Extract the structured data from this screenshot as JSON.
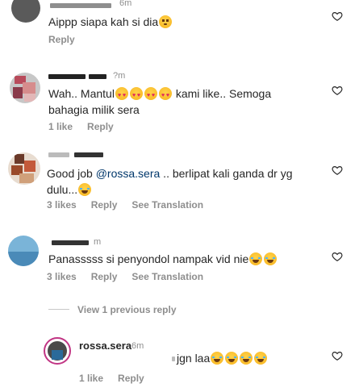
{
  "comments": [
    {
      "id": "c1",
      "username_visible": "",
      "time": "6m",
      "text": "Aippp siapa kah si dia",
      "emojis": [
        "flushed"
      ],
      "actions": {
        "likes": "",
        "reply": "Reply"
      }
    },
    {
      "id": "c2",
      "username_visible": "",
      "time": "?m",
      "text_parts": [
        "Wah.. Mantul",
        " kami like.. Semoga",
        "bahagia milik sera"
      ],
      "emojis": [
        "heart-eyes",
        "heart-eyes",
        "heart-eyes",
        "heart-eyes"
      ],
      "actions": {
        "likes": "1 like",
        "reply": "Reply"
      }
    },
    {
      "id": "c3",
      "username_visible": "",
      "time": "",
      "text_parts": [
        "Good job ",
        "@rossa.sera",
        " .. berlipat kali ganda dr yg",
        "dulu..."
      ],
      "emojis": [
        "laughing"
      ],
      "actions": {
        "likes": "3 likes",
        "reply": "Reply",
        "translate": "See Translation"
      }
    },
    {
      "id": "c4",
      "username_visible": "",
      "time": "m",
      "text": "Panasssss si penyondol nampak vid nie",
      "emojis": [
        "laughing",
        "laughing"
      ],
      "actions": {
        "likes": "3 likes",
        "reply": "Reply",
        "translate": "See Translation"
      }
    }
  ],
  "replies_toggle": {
    "label": "View 1 previous reply"
  },
  "owner_reply": {
    "username": "rossa.sera",
    "time": "6m",
    "text": "jgn laa",
    "emojis": [
      "laughing",
      "laughing",
      "laughing",
      "laughing"
    ],
    "actions": {
      "likes": "1 like",
      "reply": "Reply"
    }
  },
  "icons": {
    "like": "heart-outline-icon"
  }
}
